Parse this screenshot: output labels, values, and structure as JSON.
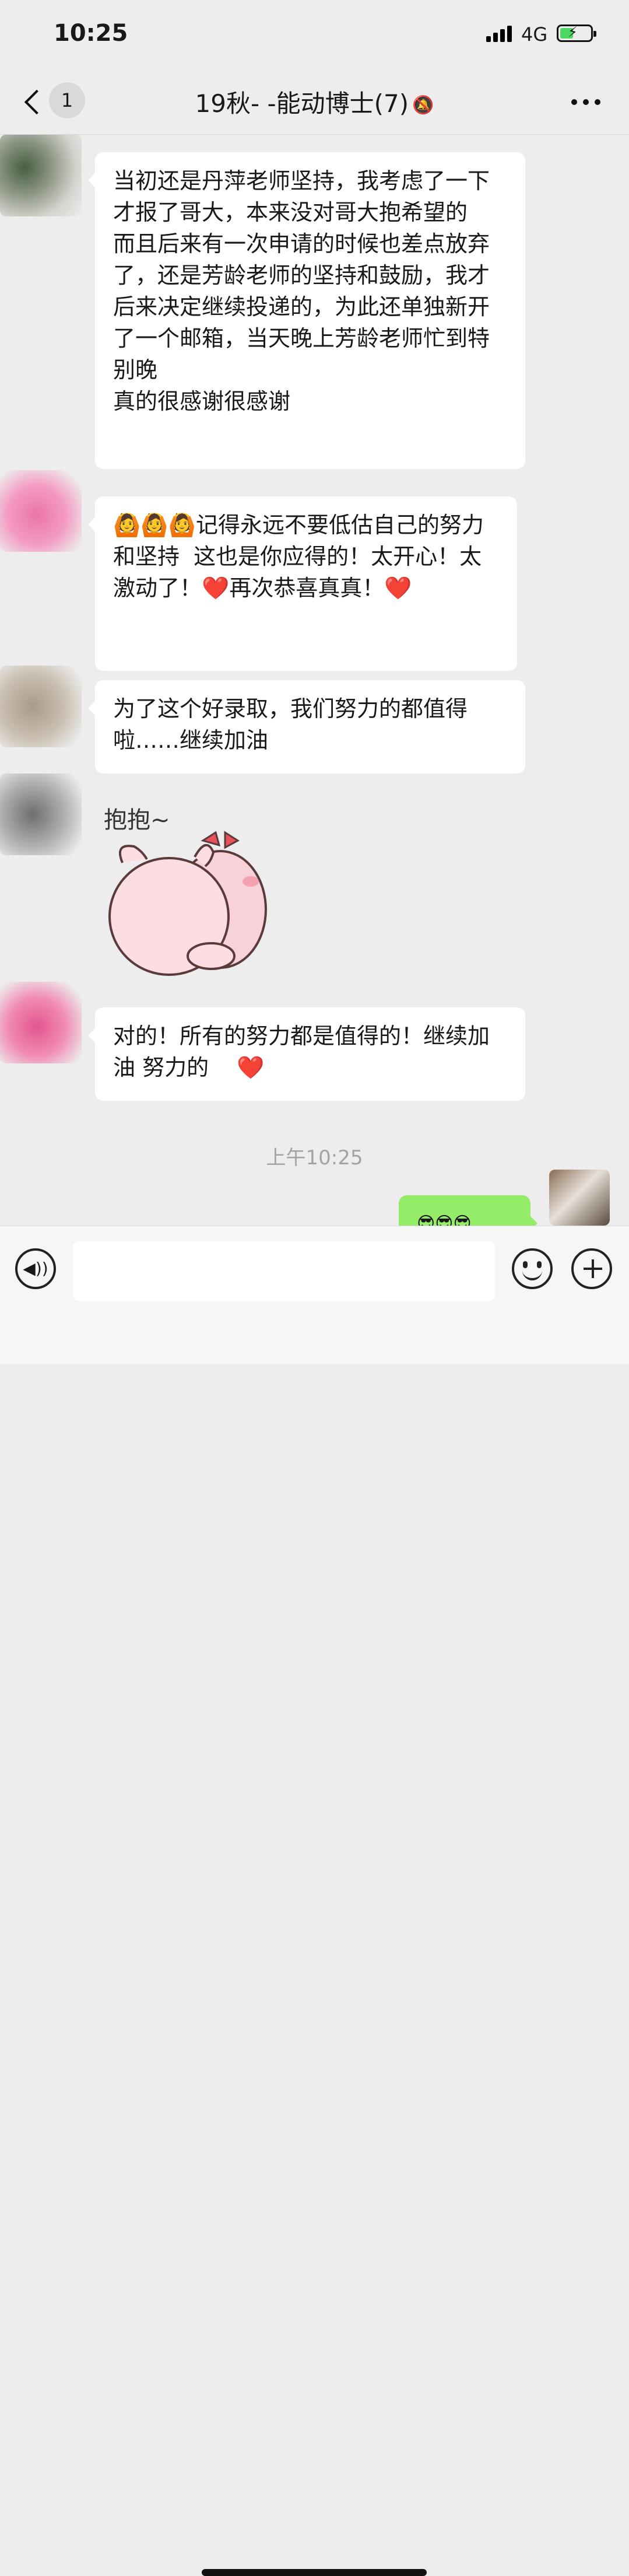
{
  "status": {
    "time": "10:25",
    "network": "4G"
  },
  "navbar": {
    "badge": "1",
    "title": "19秋-      -能动博士(7)"
  },
  "messages": [
    "当初还是丹萍老师坚持，我考虑了一下才报了哥大，本来没对哥大抱希望的\n而且后来有一次申请的时候也差点放弃了，还是芳龄老师的坚持和鼓励，我才后来决定继续投递的，为此还单独新开了一个邮箱，当天晚上芳龄老师忙到特别晚\n真的很感谢很感谢",
    "🙆🙆🙆记得永远不要低估自己的努力和坚持  这也是你应得的！太开心！太激动了！❤️再次恭喜真真！❤️",
    "为了这个好录取，我们努力的都值得啦……继续加油",
    "对的！所有的努力都是值得的！继续加油 努力的    ❤️",
    "😎😎😎"
  ],
  "sticker": {
    "text": "抱抱~"
  },
  "timestamp": "上午10:25",
  "colors": {
    "background": "#ededed",
    "bubble_in": "#ffffff",
    "bubble_out": "#95ec69"
  },
  "icons": {
    "back": "chevron-left-icon",
    "mute": "bell-off-icon",
    "more": "more-icon",
    "voice": "voice-icon",
    "emoji": "emoji-icon",
    "plus": "plus-icon"
  }
}
